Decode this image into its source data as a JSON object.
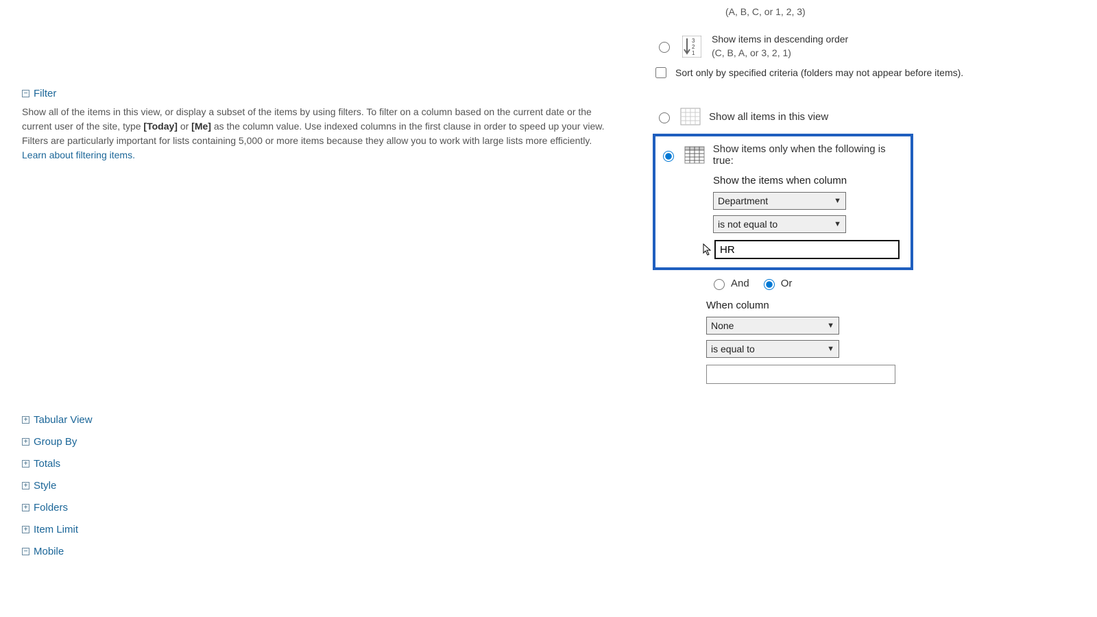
{
  "sort": {
    "asc_hint": "(A, B, C, or 1, 2, 3)",
    "desc_label": "Show items in descending order",
    "desc_hint": "(C, B, A, or 3, 2, 1)",
    "sort_only_label": "Sort only by specified criteria (folders may not appear before items)."
  },
  "filter": {
    "title": "Filter",
    "desc_1": "Show all of the items in this view, or display a subset of the items by using filters. To filter on a column based on the current date or the current user of the site, type ",
    "token_today": "[Today]",
    "desc_or": " or ",
    "token_me": "[Me]",
    "desc_2": " as the column value. Use indexed columns in the first clause in order to speed up your view. Filters are particularly important for lists containing 5,000 or more items because they allow you to work with large lists more efficiently. ",
    "learn_link": "Learn about filtering items.",
    "show_all_label": "Show all items in this view",
    "show_only_label": "Show items only when the following is true:",
    "when_label_1": "Show the items when column",
    "column_1": "Department",
    "op_1": "is not equal to",
    "value_1": "HR",
    "and_label": "And",
    "or_label": "Or",
    "when_label_2": "When column",
    "column_2": "None",
    "op_2": "is equal to",
    "value_2": ""
  },
  "sections": {
    "tabular": "Tabular View",
    "groupby": "Group By",
    "totals": "Totals",
    "style": "Style",
    "folders": "Folders",
    "itemlimit": "Item Limit",
    "mobile": "Mobile"
  }
}
